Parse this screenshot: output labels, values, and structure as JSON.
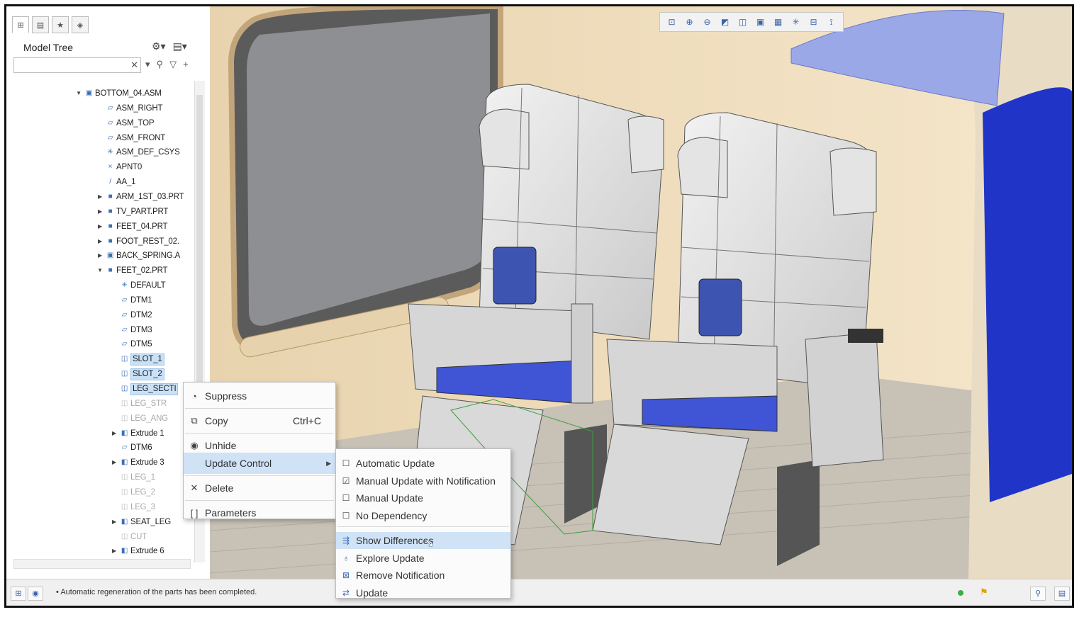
{
  "model_tree": {
    "title": "Model Tree",
    "search_value": "",
    "items": [
      {
        "label": "BOTTOM_04.ASM",
        "indent": 0,
        "toggle": "▼",
        "icon": "▣",
        "state": "normal"
      },
      {
        "label": "ASM_RIGHT",
        "indent": 1,
        "toggle": "",
        "icon": "▱",
        "state": "normal"
      },
      {
        "label": "ASM_TOP",
        "indent": 1,
        "toggle": "",
        "icon": "▱",
        "state": "normal"
      },
      {
        "label": "ASM_FRONT",
        "indent": 1,
        "toggle": "",
        "icon": "▱",
        "state": "normal"
      },
      {
        "label": "ASM_DEF_CSYS",
        "indent": 1,
        "toggle": "",
        "icon": "✳",
        "state": "normal"
      },
      {
        "label": "APNT0",
        "indent": 1,
        "toggle": "",
        "icon": "×",
        "state": "normal"
      },
      {
        "label": "AA_1",
        "indent": 1,
        "toggle": "",
        "icon": "/",
        "state": "normal"
      },
      {
        "label": "ARM_1ST_03.PRT",
        "indent": 1,
        "toggle": "▶",
        "icon": "■",
        "state": "normal"
      },
      {
        "label": "TV_PART.PRT",
        "indent": 1,
        "toggle": "▶",
        "icon": "■",
        "state": "normal"
      },
      {
        "label": "FEET_04.PRT",
        "indent": 1,
        "toggle": "▶",
        "icon": "■",
        "state": "normal"
      },
      {
        "label": "FOOT_REST_02.",
        "indent": 1,
        "toggle": "▶",
        "icon": "■",
        "state": "normal"
      },
      {
        "label": "BACK_SPRING.A",
        "indent": 1,
        "toggle": "▶",
        "icon": "▣",
        "state": "normal"
      },
      {
        "label": "FEET_02.PRT",
        "indent": 1,
        "toggle": "▼",
        "icon": "■",
        "state": "normal"
      },
      {
        "label": "DEFAULT",
        "indent": 2,
        "toggle": "",
        "icon": "✳",
        "state": "normal"
      },
      {
        "label": "DTM1",
        "indent": 2,
        "toggle": "",
        "icon": "▱",
        "state": "normal"
      },
      {
        "label": "DTM2",
        "indent": 2,
        "toggle": "",
        "icon": "▱",
        "state": "normal"
      },
      {
        "label": "DTM3",
        "indent": 2,
        "toggle": "",
        "icon": "▱",
        "state": "normal"
      },
      {
        "label": "DTM5",
        "indent": 2,
        "toggle": "",
        "icon": "▱",
        "state": "normal"
      },
      {
        "label": "SLOT_1",
        "indent": 2,
        "toggle": "",
        "icon": "◫",
        "state": "selected"
      },
      {
        "label": "SLOT_2",
        "indent": 2,
        "toggle": "",
        "icon": "◫",
        "state": "selected"
      },
      {
        "label": "LEG_SECTI",
        "indent": 2,
        "toggle": "",
        "icon": "◫",
        "state": "selected"
      },
      {
        "label": "LEG_STR",
        "indent": 2,
        "toggle": "",
        "icon": "◫",
        "state": "dim"
      },
      {
        "label": "LEG_ANG",
        "indent": 2,
        "toggle": "",
        "icon": "◫",
        "state": "dim"
      },
      {
        "label": "Extrude 1",
        "indent": 2,
        "toggle": "▶",
        "icon": "◧",
        "state": "normal"
      },
      {
        "label": "DTM6",
        "indent": 2,
        "toggle": "",
        "icon": "▱",
        "state": "normal"
      },
      {
        "label": "Extrude 3",
        "indent": 2,
        "toggle": "▶",
        "icon": "◧",
        "state": "normal"
      },
      {
        "label": "LEG_1",
        "indent": 2,
        "toggle": "",
        "icon": "◫",
        "state": "dim"
      },
      {
        "label": "LEG_2",
        "indent": 2,
        "toggle": "",
        "icon": "◫",
        "state": "dim"
      },
      {
        "label": "LEG_3",
        "indent": 2,
        "toggle": "",
        "icon": "◫",
        "state": "dim"
      },
      {
        "label": "SEAT_LEG",
        "indent": 2,
        "toggle": "▶",
        "icon": "◧",
        "state": "normal"
      },
      {
        "label": "CUT",
        "indent": 2,
        "toggle": "",
        "icon": "◫",
        "state": "dim"
      },
      {
        "label": "Extrude 6",
        "indent": 2,
        "toggle": "▶",
        "icon": "◧",
        "state": "normal"
      }
    ]
  },
  "context_menu": {
    "items": [
      {
        "label": "Suppress",
        "icon": "suppress-icon",
        "glyph": "◔",
        "shortcut": "",
        "submenu": false,
        "highlighted": false
      },
      {
        "label": "Copy",
        "icon": "copy-icon",
        "glyph": "⧉",
        "shortcut": "Ctrl+C",
        "submenu": false,
        "highlighted": false
      },
      {
        "label": "Unhide",
        "icon": "eye-icon",
        "glyph": "◉",
        "shortcut": "",
        "submenu": false,
        "highlighted": false
      },
      {
        "label": "Update Control",
        "icon": "",
        "glyph": "",
        "shortcut": "",
        "submenu": true,
        "highlighted": true
      },
      {
        "label": "Delete",
        "icon": "delete-icon",
        "glyph": "✕",
        "shortcut": "",
        "submenu": false,
        "highlighted": false
      },
      {
        "label": "Parameters",
        "icon": "parameters-icon",
        "glyph": "[ ]",
        "shortcut": "",
        "submenu": false,
        "highlighted": false
      }
    ]
  },
  "update_submenu": {
    "options": [
      {
        "label": "Automatic Update",
        "checked": false
      },
      {
        "label": "Manual Update with Notification",
        "checked": true
      },
      {
        "label": "Manual Update",
        "checked": false
      },
      {
        "label": "No Dependency",
        "checked": false
      }
    ],
    "actions": [
      {
        "label": "Show Differences",
        "icon": "show-differences-icon",
        "glyph": "⇶",
        "highlighted": true
      },
      {
        "label": "Explore Update",
        "icon": "explore-update-icon",
        "glyph": "♁",
        "highlighted": false
      },
      {
        "label": "Remove Notification",
        "icon": "remove-notification-icon",
        "glyph": "⊠",
        "highlighted": false
      },
      {
        "label": "Update",
        "icon": "update-icon",
        "glyph": "⇄",
        "highlighted": false
      }
    ]
  },
  "status_bar": {
    "message": "Automatic regeneration of the parts has been completed."
  },
  "colors": {
    "accent": "#3b6fb6",
    "selection": "#c9e1f7",
    "menu_highlight": "#cfe2f6",
    "seat_blue": "#3a50d0",
    "wall": "#f2e2c6"
  }
}
